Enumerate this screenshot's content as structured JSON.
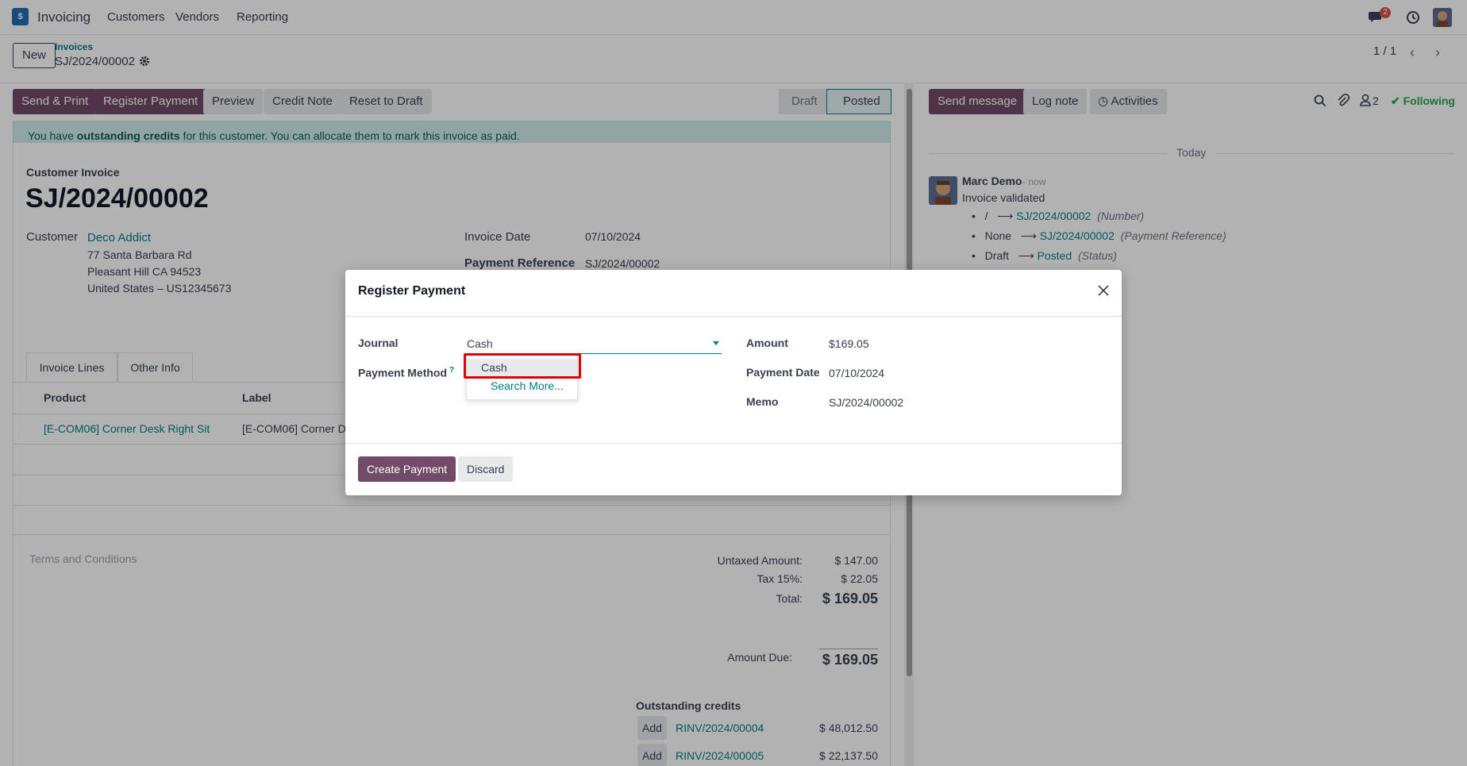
{
  "nav": {
    "app_name": "Invoicing",
    "app_icon_glyph": "$",
    "menu": [
      "Customers",
      "Vendors",
      "Reporting"
    ],
    "messages_badge": "2"
  },
  "control_panel": {
    "new_label": "New",
    "breadcrumb_parent": "Invoices",
    "breadcrumb_current": "SJ/2024/00002",
    "pager": "1 / 1"
  },
  "actions": {
    "send_print": "Send & Print",
    "register_payment": "Register Payment",
    "preview": "Preview",
    "credit_note": "Credit Note",
    "reset_to_draft": "Reset to Draft"
  },
  "statusbar": {
    "draft": "Draft",
    "posted": "Posted"
  },
  "alert": {
    "prefix": "You have ",
    "bold": "outstanding credits",
    "suffix": " for this customer. You can allocate them to mark this invoice as paid."
  },
  "invoice": {
    "type_label": "Customer Invoice",
    "number": "SJ/2024/00002",
    "customer_label": "Customer",
    "customer_name": "Deco Addict",
    "address": [
      "77 Santa Barbara Rd",
      "Pleasant Hill CA 94523",
      "United States – US12345673"
    ],
    "invoice_date_label": "Invoice Date",
    "invoice_date": "07/10/2024",
    "payment_ref_label": "Payment Reference",
    "payment_ref": "SJ/2024/00002"
  },
  "tabs": [
    "Invoice Lines",
    "Other Info"
  ],
  "lines": {
    "headers": [
      "Product",
      "Label"
    ],
    "rows": [
      {
        "product": "[E-COM06] Corner Desk Right Sit",
        "label": "[E-COM06] Corner De"
      }
    ]
  },
  "terms_placeholder": "Terms and Conditions",
  "totals": {
    "untaxed_label": "Untaxed Amount:",
    "untaxed": "$ 147.00",
    "tax_label": "Tax 15%:",
    "tax": "$ 22.05",
    "total_label": "Total:",
    "total": "$ 169.05",
    "due_label": "Amount Due:",
    "due": "$ 169.05"
  },
  "outstanding": {
    "title": "Outstanding credits",
    "add_label": "Add",
    "items": [
      {
        "ref": "RINV/2024/00004",
        "amount": "$ 48,012.50"
      },
      {
        "ref": "RINV/2024/00005",
        "amount": "$ 22,137.50"
      }
    ]
  },
  "chatter": {
    "send_message": "Send message",
    "log_note": "Log note",
    "activities": "Activities",
    "followers_count": "2",
    "following": "Following",
    "date_separator": "Today",
    "author": "Marc Demo",
    "time": "- now",
    "body": "Invoice validated",
    "changes": [
      {
        "old": "/",
        "new": "SJ/2024/00002",
        "field": "(Number)"
      },
      {
        "old": "None",
        "new": "SJ/2024/00002",
        "field": "(Payment Reference)"
      },
      {
        "old": "Draft",
        "new": "Posted",
        "field": "(Status)"
      }
    ]
  },
  "dialog": {
    "title": "Register Payment",
    "journal_label": "Journal",
    "journal_value": "Cash",
    "payment_method_label": "Payment Method",
    "dropdown_options": [
      "Cash"
    ],
    "search_more": "Search More...",
    "amount_label": "Amount",
    "amount": "$169.05",
    "payment_date_label": "Payment Date",
    "payment_date": "07/10/2024",
    "memo_label": "Memo",
    "memo": "SJ/2024/00002",
    "create_button": "Create Payment",
    "discard_button": "Discard"
  },
  "colors": {
    "primary": "#714b67",
    "link": "#017e84",
    "alert_bg": "#d2ecec",
    "highlight": "#e00000",
    "following": "#28a745"
  }
}
